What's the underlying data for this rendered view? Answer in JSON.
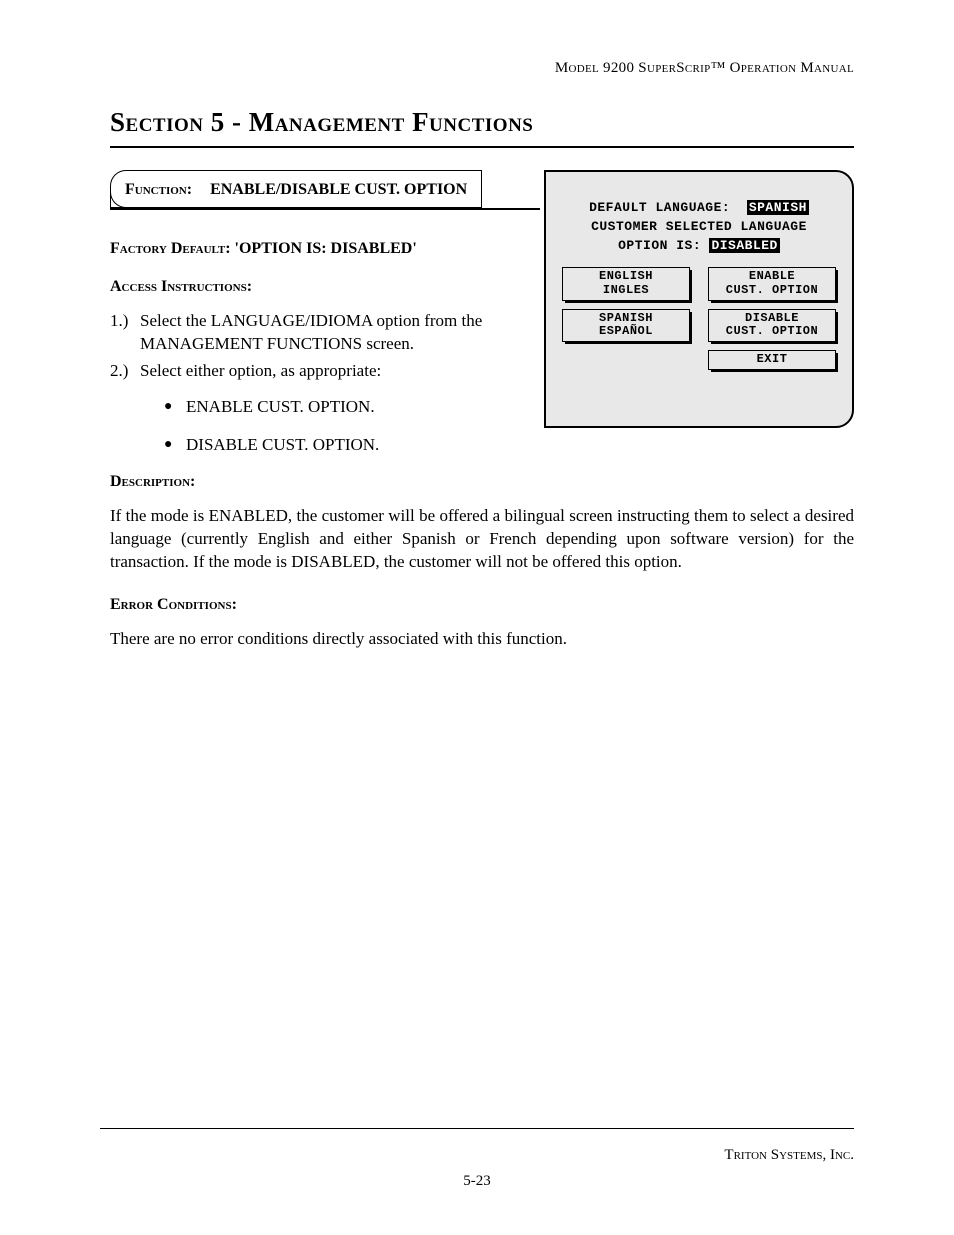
{
  "header": {
    "right": "Model 9200 SuperScrip™ Operation Manual"
  },
  "section_title": "Section 5 - Management Functions",
  "function_box": {
    "label": "Function:",
    "value": "ENABLE/DISABLE CUST. OPTION"
  },
  "factory_default": {
    "label": "Factory Default:",
    "value": "'OPTION IS: DISABLED'"
  },
  "access": {
    "heading": "Access Instructions:",
    "steps": [
      {
        "num": "1.)",
        "text": "Select the LANGUAGE/IDIOMA option from the MANAGEMENT FUNCTIONS screen."
      },
      {
        "num": "2.)",
        "text": "Select either option, as appropriate:"
      }
    ],
    "bullets": [
      "ENABLE CUST. OPTION.",
      "DISABLE CUST. OPTION."
    ]
  },
  "description": {
    "heading": "Description:",
    "text": "If the mode is ENABLED, the customer will be offered a bilingual screen instructing them to select a desired language (currently English and either Spanish or French depending upon software version) for the transaction. If the mode is DISABLED, the customer will not be offered this option."
  },
  "error": {
    "heading": "Error Conditions:",
    "text": "There are no error conditions directly associated with this function."
  },
  "terminal": {
    "line1_label": "DEFAULT LANGUAGE:",
    "line1_value": "SPANISH",
    "line2": "CUSTOMER SELECTED LANGUAGE",
    "line3_label": "OPTION IS:",
    "line3_value": "DISABLED",
    "buttons": {
      "english": {
        "l1": "ENGLISH",
        "l2": "INGLES"
      },
      "enable": {
        "l1": "ENABLE",
        "l2": "CUST. OPTION"
      },
      "spanish": {
        "l1": "SPANISH",
        "l2": "ESPAÑOL"
      },
      "disable": {
        "l1": "DISABLE",
        "l2": "CUST. OPTION"
      },
      "exit": {
        "l1": "EXIT"
      }
    }
  },
  "footer": {
    "right": "Triton Systems, Inc.",
    "center": "5-23"
  }
}
